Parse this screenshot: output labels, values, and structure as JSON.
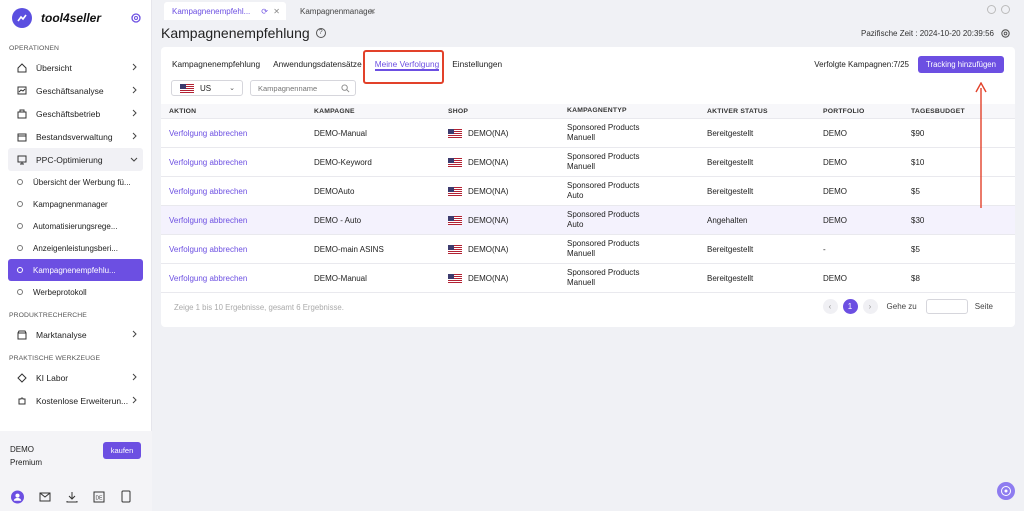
{
  "app": {
    "name": "tool4seller"
  },
  "sidebar": {
    "sections": [
      {
        "title": "OPERATIONEN"
      },
      {
        "title": "PRODUKTRECHERCHE"
      },
      {
        "title": "PRAKTISCHE WERKZEUGE"
      }
    ],
    "items": [
      {
        "label": "Übersicht",
        "icon": "home-icon"
      },
      {
        "label": "Geschäftsanalyse",
        "icon": "chart-icon"
      },
      {
        "label": "Geschäftsbetrieb",
        "icon": "briefcase-icon"
      },
      {
        "label": "Bestandsverwaltung",
        "icon": "inventory-icon"
      },
      {
        "label": "PPC-Optimierung",
        "icon": "monitor-icon"
      }
    ],
    "ppc_sub": [
      {
        "label": "Übersicht der Werbung fü..."
      },
      {
        "label": "Kampagnenmanager"
      },
      {
        "label": "Automatisierungsrege..."
      },
      {
        "label": "Anzeigenleistungsberi..."
      },
      {
        "label": "Kampagnenempfehlu..."
      },
      {
        "label": "Werbeprotokoll"
      }
    ],
    "research": [
      {
        "label": "Marktanalyse",
        "icon": "store-icon"
      }
    ],
    "tools": [
      {
        "label": "KI Labor",
        "icon": "ai-icon"
      },
      {
        "label": "Kostenlose Erweiterun...",
        "icon": "puzzle-icon"
      }
    ],
    "plan": {
      "name": "DEMO",
      "tier": "Premium",
      "buy_label": "kaufen"
    }
  },
  "tabs": [
    {
      "label": "Kampagnenempfehl..."
    },
    {
      "label": "Kampagnenmanager"
    }
  ],
  "page": {
    "title": "Kampagnenempfehlung",
    "timezone": "Pazifische Zeit : 2024-10-20 20:39:56"
  },
  "subtabs": [
    {
      "label": "Kampagnenempfehlung"
    },
    {
      "label": "Anwendungsdatensätze"
    },
    {
      "label": "Meine Verfolgung"
    },
    {
      "label": "Einstellungen"
    }
  ],
  "toolbar": {
    "tracked": "Verfolgte Kampagnen:7/25",
    "add_button": "Tracking hinzufügen",
    "market": "US",
    "search_placeholder": "Kampagnenname"
  },
  "table": {
    "headers": [
      "AKTION",
      "KAMPAGNE",
      "SHOP",
      "KAMPAGNENTYP",
      "AKTIVER STATUS",
      "PORTFOLIO",
      "TAGESBUDGET"
    ],
    "rows": [
      {
        "action": "Verfolgung abbrechen",
        "campaign": "DEMO-Manual",
        "shop": "DEMO(NA)",
        "type1": "Sponsored Products",
        "type2": "Manuell",
        "status": "Bereitgestellt",
        "portfolio": "DEMO",
        "budget": "$90"
      },
      {
        "action": "Verfolgung abbrechen",
        "campaign": "DEMO-Keyword",
        "shop": "DEMO(NA)",
        "type1": "Sponsored Products",
        "type2": "Manuell",
        "status": "Bereitgestellt",
        "portfolio": "DEMO",
        "budget": "$10"
      },
      {
        "action": "Verfolgung abbrechen",
        "campaign": "DEMOAuto",
        "shop": "DEMO(NA)",
        "type1": "Sponsored Products",
        "type2": "Auto",
        "status": "Bereitgestellt",
        "portfolio": "DEMO",
        "budget": "$5"
      },
      {
        "action": "Verfolgung abbrechen",
        "campaign": "DEMO - Auto",
        "shop": "DEMO(NA)",
        "type1": "Sponsored Products",
        "type2": "Auto",
        "status": "Angehalten",
        "portfolio": "DEMO",
        "budget": "$30"
      },
      {
        "action": "Verfolgung abbrechen",
        "campaign": "DEMO-main ASINS",
        "shop": "DEMO(NA)",
        "type1": "Sponsored Products",
        "type2": "Manuell",
        "status": "Bereitgestellt",
        "portfolio": "-",
        "budget": "$5"
      },
      {
        "action": "Verfolgung abbrechen",
        "campaign": "DEMO-Manual",
        "shop": "DEMO(NA)",
        "type1": "Sponsored Products",
        "type2": "Manuell",
        "status": "Bereitgestellt",
        "portfolio": "DEMO",
        "budget": "$8"
      }
    ]
  },
  "pagination": {
    "summary": "Zeige 1 bis 10 Ergebnisse, gesamt 6 Ergebnisse.",
    "current": "1",
    "goto_label": "Gehe zu",
    "page_label": "Seite"
  },
  "colors": {
    "accent": "#6c4fe2",
    "highlight": "#e2412a"
  }
}
